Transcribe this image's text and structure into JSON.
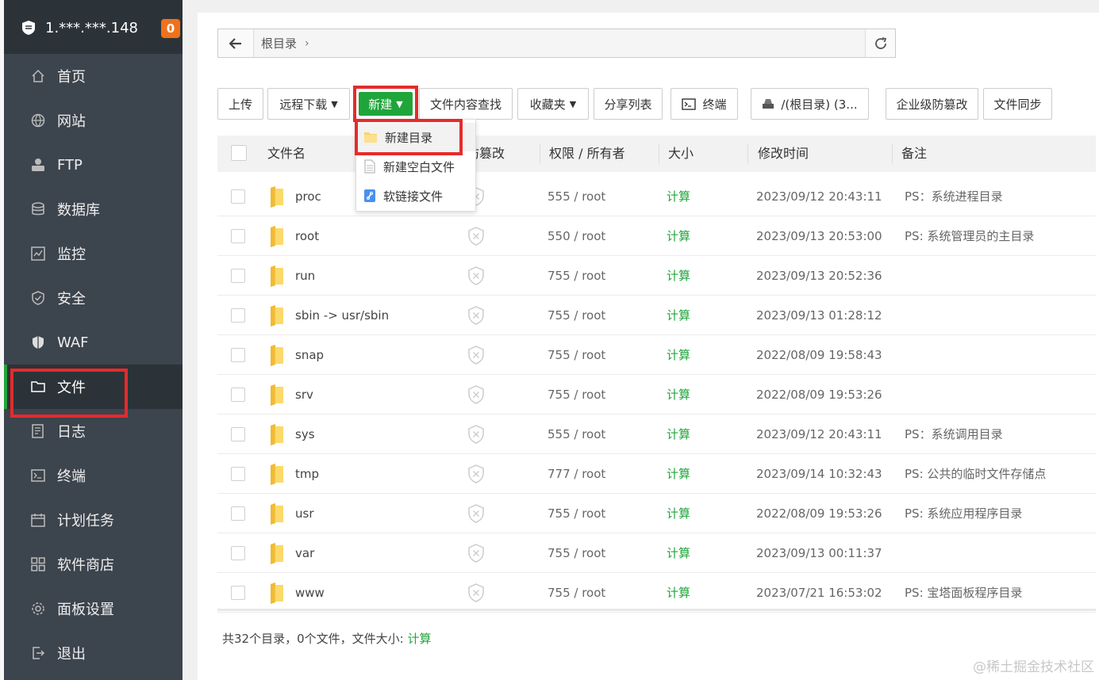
{
  "sidebar": {
    "server": "1.***.***.148",
    "badge": "0",
    "items": [
      {
        "label": "首页",
        "icon": "home-icon"
      },
      {
        "label": "网站",
        "icon": "globe-icon"
      },
      {
        "label": "FTP",
        "icon": "ftp-icon"
      },
      {
        "label": "数据库",
        "icon": "database-icon"
      },
      {
        "label": "监控",
        "icon": "monitor-icon"
      },
      {
        "label": "安全",
        "icon": "shield-check-icon"
      },
      {
        "label": "WAF",
        "icon": "waf-shield-icon"
      },
      {
        "label": "文件",
        "icon": "folder-icon",
        "active": true
      },
      {
        "label": "日志",
        "icon": "log-icon"
      },
      {
        "label": "终端",
        "icon": "terminal-icon"
      },
      {
        "label": "计划任务",
        "icon": "calendar-icon"
      },
      {
        "label": "软件商店",
        "icon": "apps-icon"
      },
      {
        "label": "面板设置",
        "icon": "gear-icon"
      },
      {
        "label": "退出",
        "icon": "logout-icon"
      }
    ]
  },
  "pathbar": {
    "crumb": "根目录",
    "sep": "›"
  },
  "toolbar": {
    "upload": "上传",
    "remote_download": "远程下载",
    "new": "新建",
    "content_search": "文件内容查找",
    "favorites": "收藏夹",
    "share_list": "分享列表",
    "terminal": "终端",
    "disk": "/(根目录) (3...",
    "anti_tamper": "企业级防篡改",
    "file_sync": "文件同步"
  },
  "dropdown": {
    "items": [
      "新建目录",
      "新建空白文件",
      "软链接文件"
    ]
  },
  "table": {
    "headers": {
      "name": "文件名",
      "tamper": "防篡改",
      "perm": "权限 / 所有者",
      "size": "大小",
      "mtime": "修改时间",
      "note": "备注"
    },
    "rows": [
      {
        "name": "proc",
        "perm": "555 / root",
        "size": "计算",
        "mtime": "2023/09/12 20:43:11",
        "note": "PS：系统进程目录"
      },
      {
        "name": "root",
        "perm": "550 / root",
        "size": "计算",
        "mtime": "2023/09/13 20:53:00",
        "note": "PS: 系统管理员的主目录"
      },
      {
        "name": "run",
        "perm": "755 / root",
        "size": "计算",
        "mtime": "2023/09/13 20:52:36",
        "note": ""
      },
      {
        "name": "sbin -> usr/sbin",
        "perm": "755 / root",
        "size": "计算",
        "mtime": "2023/09/13 01:28:12",
        "note": ""
      },
      {
        "name": "snap",
        "perm": "755 / root",
        "size": "计算",
        "mtime": "2022/08/09 19:58:43",
        "note": ""
      },
      {
        "name": "srv",
        "perm": "755 / root",
        "size": "计算",
        "mtime": "2022/08/09 19:53:26",
        "note": ""
      },
      {
        "name": "sys",
        "perm": "555 / root",
        "size": "计算",
        "mtime": "2023/09/12 20:43:11",
        "note": "PS：系统调用目录"
      },
      {
        "name": "tmp",
        "perm": "777 / root",
        "size": "计算",
        "mtime": "2023/09/14 10:32:43",
        "note": "PS: 公共的临时文件存储点"
      },
      {
        "name": "usr",
        "perm": "755 / root",
        "size": "计算",
        "mtime": "2022/08/09 19:53:26",
        "note": "PS: 系统应用程序目录"
      },
      {
        "name": "var",
        "perm": "755 / root",
        "size": "计算",
        "mtime": "2023/09/13 00:11:37",
        "note": ""
      },
      {
        "name": "www",
        "perm": "755 / root",
        "size": "计算",
        "mtime": "2023/07/21 16:53:02",
        "note": "PS: 宝塔面板程序目录"
      }
    ]
  },
  "footer": {
    "summary": "共32个目录，0个文件，文件大小: ",
    "link": "计算"
  },
  "watermark": "@稀土掘金技术社区",
  "colors": {
    "accent": "#20a53a",
    "sidebar": "#3c444d",
    "badge": "#f0711b",
    "highlight": "#e52b2b"
  }
}
